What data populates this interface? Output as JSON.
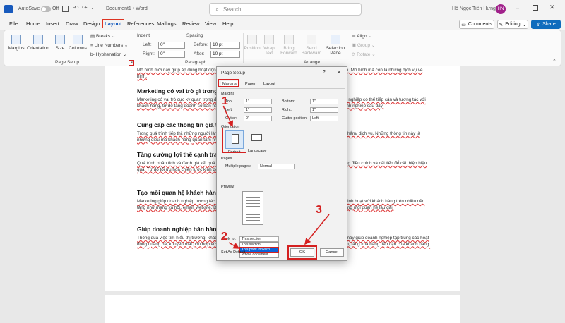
{
  "titlebar": {
    "autosave_label": "AutoSave",
    "autosave_state": "Off",
    "doc_title": "Document1 • Word",
    "search_placeholder": "Search",
    "user_name": "Hồ Ngọc Tiến Hưng",
    "user_initials": "HN"
  },
  "menu": {
    "items": [
      "File",
      "Home",
      "Insert",
      "Draw",
      "Design",
      "Layout",
      "References",
      "Mailings",
      "Review",
      "View",
      "Help"
    ],
    "active": "Layout",
    "comments": "Comments",
    "editing": "Editing",
    "share": "Share"
  },
  "ribbon": {
    "page_setup": {
      "label": "Page Setup",
      "margins": "Margins",
      "orientation": "Orientation",
      "size": "Size",
      "columns": "Columns",
      "breaks": "Breaks",
      "line_numbers": "Line Numbers",
      "hyphenation": "Hyphenation"
    },
    "paragraph": {
      "label": "Paragraph",
      "indent": "Indent",
      "spacing": "Spacing",
      "left_label": "Left:",
      "right_label": "Right:",
      "before_label": "Before:",
      "after_label": "After:",
      "left_value": "0\"",
      "right_value": "0\"",
      "before_value": "10 pt",
      "after_value": "10 pt"
    },
    "arrange": {
      "label": "Arrange",
      "position": "Position",
      "wrap_text": "Wrap Text",
      "bring_forward": "Bring Forward",
      "send_backward": "Send Backward",
      "selection_pane": "Selection Pane",
      "align": "Align",
      "group": "Group",
      "rotate": "Rotate"
    }
  },
  "document": {
    "p0": "Mô hình mới này giúp áp dụng hoạt động marketing một cách hiệu quả hơn trong các hình thức kinh doanh. Mô hình mà còn là những dịch vụ về hình.",
    "h1": "Marketing có vai trò gì trong",
    "p1": "Marketing có vai trò cực kỳ quan trọng đối với các doanh nghiệp trong thời đại số ngày nay. Nó giúp doanh nghiệp có thể tiếp cận và tương tác với khách hàng, từ đó tăng doanh số bán hàng và phát triển. Tham khảo các vai trò của marketing đối với doanh nghiệp sau đây:",
    "h2": "Cung cấp các thông tin giá trị",
    "p2": "Trong quá trình tiếp thị, những người làm marketing sẽ cung cấp cho khách hàng thông tin chi tiết về sản phẩm/ dịch vụ. Những thông tin này là những điều mà khách hàng quan tâm như giá cả, chất lượng, chương trình khuyến mãi...",
    "h3": "Tăng cường lợi thế cạnh tranh",
    "p3": "Quá trình phân tích và đánh giá kết quả marketing giúp doanh nghiệp hiểu được thị trường và đưa ra những điều chỉnh và cải tiến để cải thiện hiệu quả. Từ đó tối ưu hóa chiến lược kinh doanh và tăng cường vị thế trên thị trường.",
    "h4": "Tạo mối quan hệ khách hàng",
    "p4": "Marketing giúp doanh nghiệp tương tác và xây dựng mối quan hệ với khách hàng một cách nhanh chóng, linh hoạt với khách hàng trên nhiều nền tảng như mạng xã hội, email, website. Điều này giúp khách hàng cảm thấy được quan tâm và từ đó tạo dựng mối quan hệ lâu dài.",
    "h5": "Giúp doanh nghiệp bán hàng",
    "p5": "Thông qua việc tìm hiểu thị trường, khách hàng, marketing giúp doanh nghiệp bán được nhiều hàng. Điều này giúp doanh nghiệp tập trung các hoạt động quảng bá, khuyến mãi phù hợp với nhu cầu khách hàng. Các hoạt động này giúp thu hút sự quan tâm, tăng khả năng tiếp cận của khách hàng."
  },
  "dialog": {
    "title": "Page Setup",
    "help": "?",
    "close": "✕",
    "tabs": [
      "Margins",
      "Paper",
      "Layout"
    ],
    "margins_section": "Margins",
    "top_label": "Top:",
    "top_value": "1\"",
    "bottom_label": "Bottom:",
    "bottom_value": "1\"",
    "left_label": "Left:",
    "left_value": "1\"",
    "right_label": "Right:",
    "right_value": "1\"",
    "gutter_label": "Gutter:",
    "gutter_value": "0\"",
    "gutter_pos_label": "Gutter position:",
    "gutter_pos_value": "Left",
    "orientation_section": "Orientation",
    "portrait": "Portrait",
    "landscape": "Landscape",
    "pages_section": "Pages",
    "multiple_pages_label": "Multiple pages:",
    "multiple_pages_value": "Normal",
    "preview_section": "Preview",
    "apply_to_label": "Apply to:",
    "apply_to_value": "This section",
    "apply_options": [
      "This section",
      "This point forward",
      "Whole document"
    ],
    "set_default": "Set As Default",
    "ok": "OK",
    "cancel": "Cancel"
  },
  "annotations": {
    "step1": "1",
    "step2": "2",
    "step3": "3",
    "color": "#d42020"
  }
}
